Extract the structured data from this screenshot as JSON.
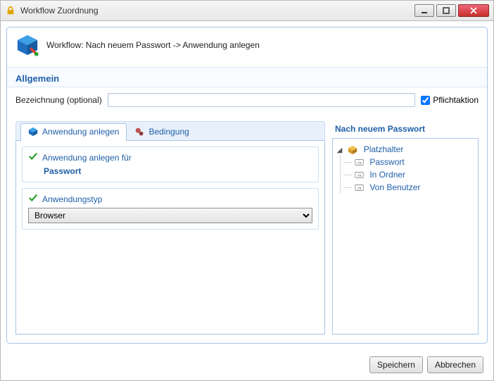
{
  "window": {
    "title": "Workflow Zuordnung"
  },
  "header": {
    "label": "Workflow:",
    "text": "Nach neuem Passwort -> Anwendung anlegen"
  },
  "section_general": {
    "title": "Allgemein"
  },
  "form": {
    "name_label": "Bezeichnung (optional)",
    "name_value": "",
    "mandatory_label": "Pflichtaktion",
    "mandatory_checked": true
  },
  "tabs": {
    "items": [
      {
        "label": "Anwendung anlegen",
        "active": true
      },
      {
        "label": "Bedingung",
        "active": false
      }
    ]
  },
  "group_target": {
    "title": "Anwendung anlegen für",
    "value": "Passwort"
  },
  "group_type": {
    "title": "Anwendungstyp",
    "value": "Browser"
  },
  "right": {
    "title": "Nach neuem Passwort",
    "tree": {
      "label": "Platzhalter",
      "children": [
        {
          "label": "Passwort"
        },
        {
          "label": "In Ordner"
        },
        {
          "label": "Von Benutzer"
        }
      ]
    }
  },
  "footer": {
    "save": "Speichern",
    "cancel": "Abbrechen"
  }
}
